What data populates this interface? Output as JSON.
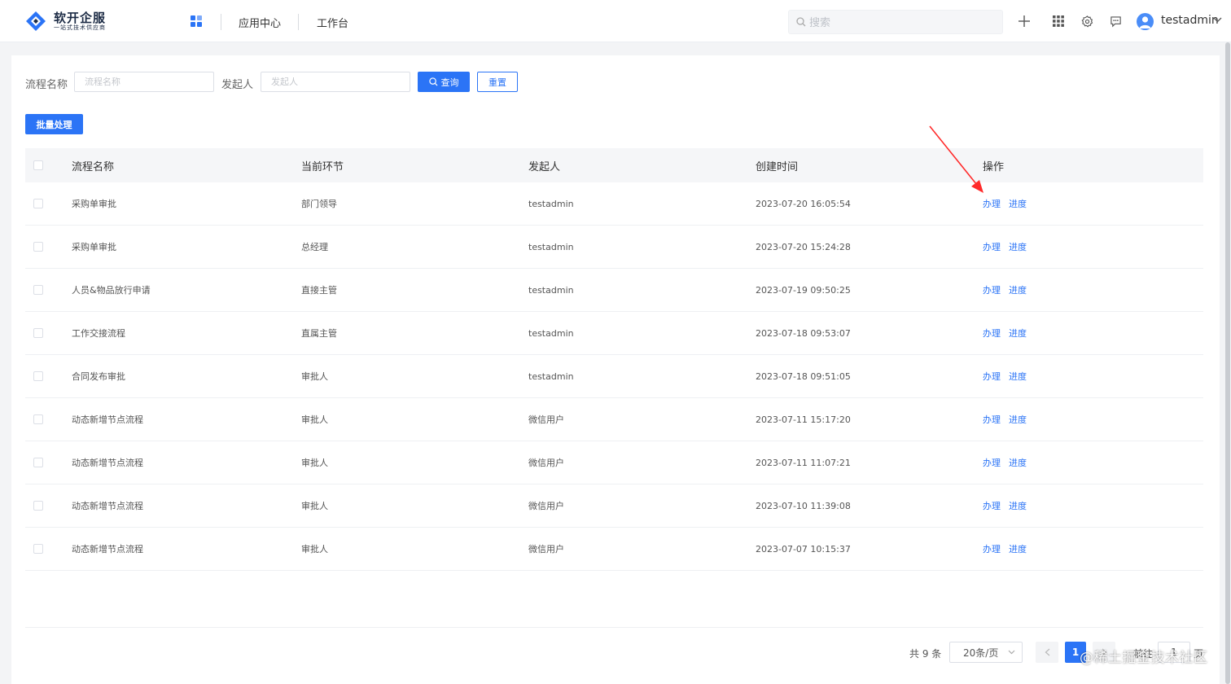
{
  "brand": {
    "title": "软开企服",
    "subtitle": "一站式技术供应商"
  },
  "nav": {
    "items": [
      "应用中心",
      "工作台"
    ]
  },
  "header": {
    "search_placeholder": "搜索",
    "username": "testadmin"
  },
  "filters": {
    "name_label": "流程名称",
    "name_placeholder": "流程名称",
    "initiator_label": "发起人",
    "initiator_placeholder": "发起人",
    "query_label": "查询",
    "reset_label": "重置"
  },
  "batch_label": "批量处理",
  "table": {
    "columns": [
      "流程名称",
      "当前环节",
      "发起人",
      "创建时间",
      "操作"
    ],
    "action_labels": [
      "办理",
      "进度"
    ],
    "rows": [
      {
        "name": "采购单审批",
        "node": "部门领导",
        "initiator": "testadmin",
        "created": "2023-07-20 16:05:54"
      },
      {
        "name": "采购单审批",
        "node": "总经理",
        "initiator": "testadmin",
        "created": "2023-07-20 15:24:28"
      },
      {
        "name": "人员&物品放行申请",
        "node": "直接主管",
        "initiator": "testadmin",
        "created": "2023-07-19 09:50:25"
      },
      {
        "name": "工作交接流程",
        "node": "直属主管",
        "initiator": "testadmin",
        "created": "2023-07-18 09:53:07"
      },
      {
        "name": "合同发布审批",
        "node": "审批人",
        "initiator": "testadmin",
        "created": "2023-07-18 09:51:05"
      },
      {
        "name": "动态新增节点流程",
        "node": "审批人",
        "initiator": "微信用户",
        "created": "2023-07-11 15:17:20"
      },
      {
        "name": "动态新增节点流程",
        "node": "审批人",
        "initiator": "微信用户",
        "created": "2023-07-11 11:07:21"
      },
      {
        "name": "动态新增节点流程",
        "node": "审批人",
        "initiator": "微信用户",
        "created": "2023-07-10 11:39:08"
      },
      {
        "name": "动态新增节点流程",
        "node": "审批人",
        "initiator": "微信用户",
        "created": "2023-07-07 10:15:37"
      }
    ]
  },
  "pagination": {
    "total_text": "共 9 条",
    "page_size": "20条/页",
    "current_page": "1",
    "goto_label": "前往",
    "goto_value": "1",
    "page_suffix": "页"
  },
  "watermark": "@稀土掘金技术社区",
  "colors": {
    "primary": "#2b74f6",
    "annotation_arrow": "#ff2a2a"
  }
}
